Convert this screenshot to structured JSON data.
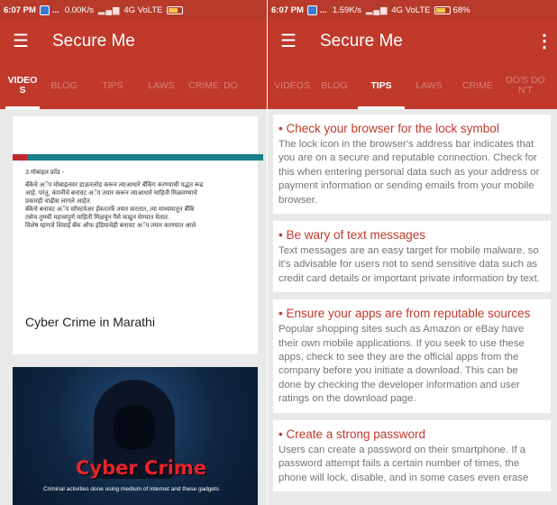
{
  "left": {
    "status": {
      "time": "6:07 PM",
      "speed": "0.00K/s",
      "network": "4G VoLTE"
    },
    "appbar": {
      "title": "Secure Me"
    },
    "tabs": [
      "VIDEOS",
      "BLOG",
      "TIPS",
      "LAWS",
      "CRIME",
      "DO"
    ],
    "active_tab": "VIDEOS",
    "card1": {
      "heading": "3.मोबाइल फ्रॉड -",
      "lines": [
        "बँकेचे अॅप मोबाइलवर डाऊनलोड करून त्याआधारे बँकिंग करण्याची पद्धत रूढ",
        "आहे. परंतु, कंपनीचे बनावट अॅप तयार करून त्याआधारे माहिती मिळवण्याचे",
        "प्रकारही वाढीस लागले आहेत.",
        "बँकेचे बनावट अॅप सॉफ्टवेअर हॅकरतर्फे तयार करतात, त्या माध्यमातून बँकिं",
        "तसेच तुमची महत्त्वपूर्ण माहिती मिळवून पैसे काढून घेण्यात येतात.",
        "विशेष म्हणजे शिवाईं बँक ऑफ इंडियाचेही बनावट अॅप तयार करण्यात आले"
      ],
      "caption": "Cyber Crime in Marathi"
    },
    "card2": {
      "title": "Cyber Crime",
      "subtitle": "Criminal activities done using medium of internet and these gadgets"
    }
  },
  "right": {
    "status": {
      "time": "6:07 PM",
      "speed": "1.59K/s",
      "network": "4G VoLTE",
      "battery": "68%"
    },
    "appbar": {
      "title": "Secure Me"
    },
    "tabs": [
      "VIDEOS",
      "BLOG",
      "TIPS",
      "LAWS",
      "CRIME",
      "DO'S DON'T"
    ],
    "active_tab": "TIPS",
    "tips": [
      {
        "title": "• Check your browser for the lock symbol",
        "text": "The lock icon in the browser's address bar indicates that you are on a secure and reputable connection. Check for this when entering personal data such as your address or payment information or sending emails from your mobile browser."
      },
      {
        "title": "• Be wary of text messages",
        "text": "Text messages are an easy target for mobile malware, so it's advisable for users not to send sensitive data such as credit card details or important private information by text."
      },
      {
        "title": "• Ensure your apps are from reputable sources",
        "text": "Popular shopping sites such as Amazon or eBay have their own mobile applications. If you seek to use these apps, check to see they are the official apps from the company before you initiate a download. This can be done by checking the developer information and user ratings on the download page."
      },
      {
        "title": "• Create a strong password",
        "text": "Users can create a password on their smartphone. If a password attempt fails a certain number of times, the phone will lock, disable, and in some cases even erase"
      }
    ]
  },
  "colors": {
    "primary": "#c0392b",
    "status_bar": "#b73a2a",
    "background": "#e9e9e9",
    "tip_title": "#c0392b",
    "tip_text": "#757575"
  }
}
